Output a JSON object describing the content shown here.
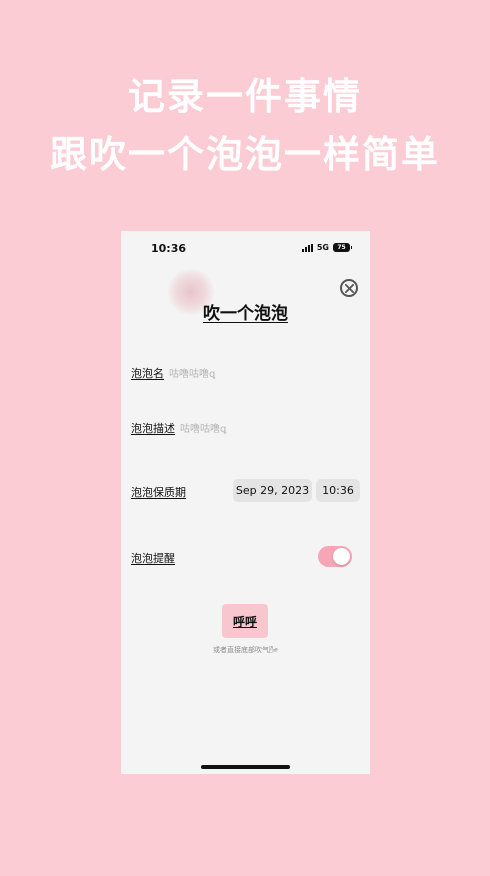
{
  "promo": {
    "line1": "记录一件事情",
    "line2": "跟吹一个泡泡一样简单"
  },
  "status": {
    "time": "10:36",
    "network": "5G",
    "battery": "75"
  },
  "form": {
    "title": "吹一个泡泡",
    "name_label": "泡泡名",
    "name_placeholder": "咕噜咕噜ꝗ",
    "desc_label": "泡泡描述",
    "desc_placeholder": "咕噜咕噜ꝗ",
    "expiry_label": "泡泡保质期",
    "expiry_date": "Sep 29, 2023",
    "expiry_time": "10:36",
    "reminder_label": "泡泡提醒",
    "reminder_on": true,
    "blow_button": "呼呼",
    "hint": "或者直接底部吹气🌬"
  },
  "colors": {
    "background": "#FCCCD5",
    "toggle_on": "#F6A6B6",
    "blow_button": "#F8C6CE"
  }
}
